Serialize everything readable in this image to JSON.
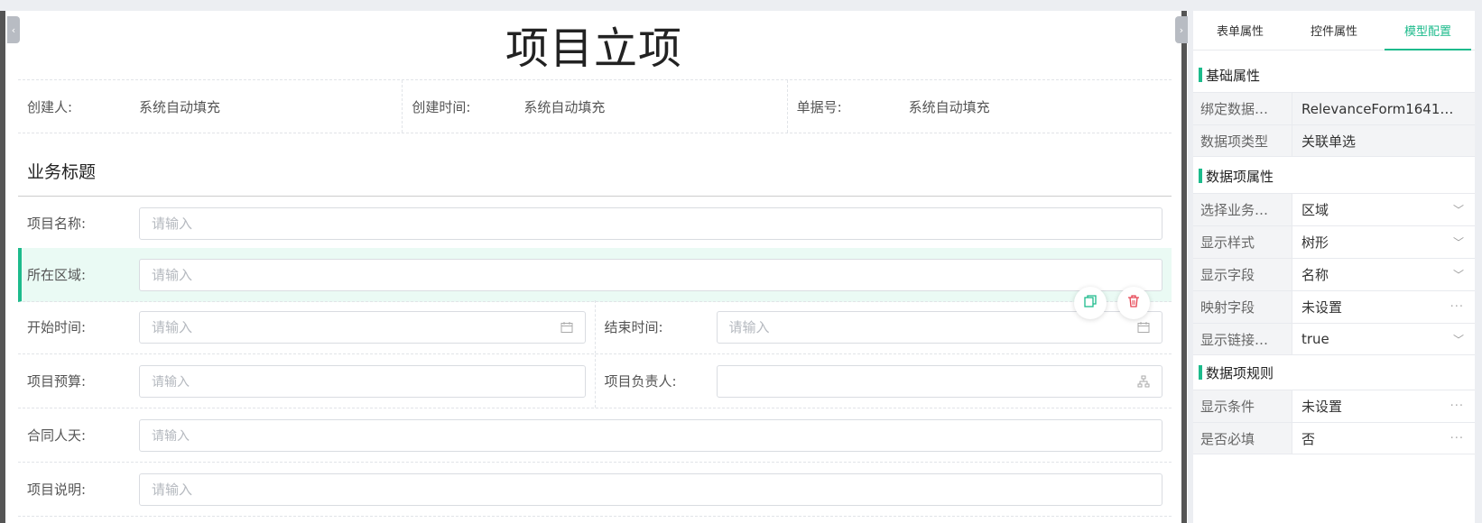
{
  "form": {
    "title": "项目立项",
    "meta": [
      {
        "label": "创建人:",
        "value": "系统自动填充"
      },
      {
        "label": "创建时间:",
        "value": "系统自动填充"
      },
      {
        "label": "单据号:",
        "value": "系统自动填充"
      }
    ],
    "section_title": "业务标题",
    "fields": {
      "project_name": {
        "label": "项目名称:",
        "placeholder": "请输入"
      },
      "region": {
        "label": "所在区域:",
        "placeholder": "请输入"
      },
      "start_time": {
        "label": "开始时间:",
        "placeholder": "请输入"
      },
      "end_time": {
        "label": "结束时间:",
        "placeholder": "请输入"
      },
      "budget": {
        "label": "项目预算:",
        "placeholder": "请输入"
      },
      "owner": {
        "label": "项目负责人:",
        "placeholder": ""
      },
      "contract_days": {
        "label": "合同人天:",
        "placeholder": "请输入"
      },
      "description": {
        "label": "项目说明:",
        "placeholder": "请输入"
      }
    }
  },
  "panel": {
    "tabs": [
      "表单属性",
      "控件属性",
      "模型配置"
    ],
    "active_tab": "模型配置",
    "groups": {
      "basic": {
        "title": "基础属性",
        "rows": [
          {
            "key": "绑定数据…",
            "value": "RelevanceForm1641…"
          },
          {
            "key": "数据项类型",
            "value": "关联单选"
          }
        ]
      },
      "item": {
        "title": "数据项属性",
        "rows": [
          {
            "key": "选择业务…",
            "value": "区域"
          },
          {
            "key": "显示样式",
            "value": "树形"
          },
          {
            "key": "显示字段",
            "value": "名称"
          },
          {
            "key": "映射字段",
            "value": "未设置"
          },
          {
            "key": "显示链接…",
            "value": "true"
          }
        ]
      },
      "rule": {
        "title": "数据项规则",
        "rows": [
          {
            "key": "显示条件",
            "value": "未设置"
          },
          {
            "key": "是否必填",
            "value": "否"
          }
        ]
      }
    }
  },
  "colors": {
    "accent": "#1dbb8c",
    "danger": "#e64553",
    "selected_row": "#eafaf4"
  },
  "icons": [
    "calendar-icon",
    "org-tree-icon",
    "copy-icon",
    "trash-icon",
    "chevron-down-icon",
    "ellipsis-icon",
    "collapse-left-icon",
    "collapse-right-icon"
  ]
}
